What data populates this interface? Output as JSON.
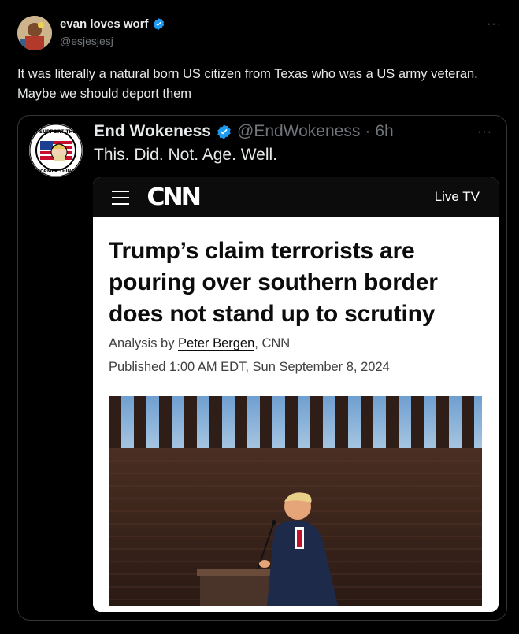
{
  "tweet": {
    "display_name": "evan loves worf",
    "handle": "@esjesjesj",
    "verified": true,
    "more": "···",
    "text": "It was literally a natural born US citizen from Texas who was a US army veteran. Maybe we should deport them"
  },
  "quoted_tweet": {
    "display_name": "End Wokeness",
    "handle": "@EndWokeness",
    "separator": "·",
    "time": "6h",
    "verified": true,
    "more": "···",
    "text": "This. Did. Not. Age. Well.",
    "avatar_text": "I SUPPORT THE FORMER THING"
  },
  "article": {
    "brand": "CNN",
    "live_tv": "Live TV",
    "headline": "Trump’s claim terrorists are pouring over southern border does not stand up to scrutiny",
    "byline_prefix": "Analysis by",
    "byline_author": "Peter Bergen",
    "byline_suffix": ", CNN",
    "published": "Published 1:00 AM EDT, Sun September 8, 2024"
  },
  "colors": {
    "background": "#000000",
    "text": "#e7e9ea",
    "muted": "#71767b",
    "verified": "#1d9bf0",
    "border": "#333639"
  }
}
